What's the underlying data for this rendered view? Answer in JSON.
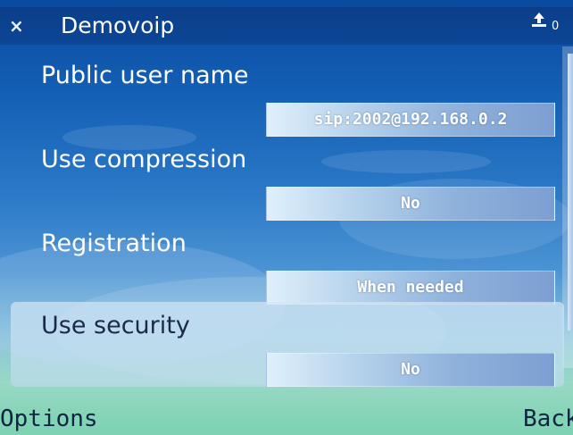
{
  "title_bar": {
    "close_glyph": "×",
    "app_title": "Demovoip",
    "status_icon": "upload-arrow-icon",
    "counter": "0"
  },
  "settings": [
    {
      "label": "Public user name",
      "value": "sip:2002@192.168.0.2"
    },
    {
      "label": "Use compression",
      "value": "No"
    },
    {
      "label": "Registration",
      "value": "When needed"
    },
    {
      "label": "Use security",
      "value": "No",
      "selected": true
    }
  ],
  "softkeys": {
    "left": "Options",
    "right": "Back"
  },
  "colors": {
    "titlebar": "#0b3e8a",
    "text_on_dark": "#ffffff",
    "text_selected": "#1a2a48",
    "value_box_start": "#dff0fb",
    "value_box_end": "#7c9ed2"
  }
}
